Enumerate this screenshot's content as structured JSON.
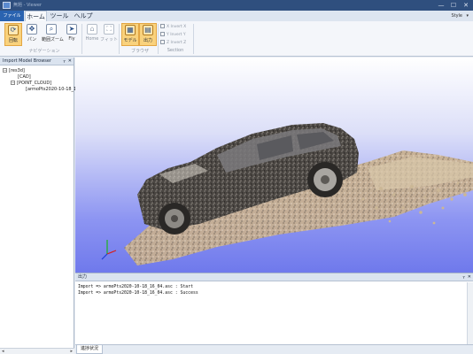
{
  "window": {
    "title": "無題 - Viewer",
    "min_glyph": "—",
    "max_glyph": "☐",
    "close_glyph": "✕"
  },
  "menu": {
    "file": "ファイル",
    "home": "ホーム",
    "tools": "ツール",
    "help": "ヘルプ",
    "style_label": "Style",
    "style_caret": "▾"
  },
  "ribbon": {
    "navigation": {
      "group_label": "ナビゲーション",
      "buttons": [
        {
          "label": "回転",
          "icon": "rotate-icon",
          "glyph": "⟳",
          "highlighted": true
        },
        {
          "label": "パン",
          "icon": "pan-icon",
          "glyph": "✥",
          "highlighted": false
        },
        {
          "label": "範囲ズーム",
          "icon": "zoom-box-icon",
          "glyph": "⌕",
          "highlighted": false
        },
        {
          "label": "Fly",
          "icon": "fly-icon",
          "glyph": "➤",
          "highlighted": false
        },
        {
          "label": "Home",
          "icon": "home-icon",
          "glyph": "⌂",
          "highlighted": false,
          "dim": true
        },
        {
          "label": "フィット",
          "icon": "fit-icon",
          "glyph": "⛶",
          "highlighted": false,
          "dim": true
        }
      ]
    },
    "browse": {
      "group_label": "ブラウザ",
      "buttons": [
        {
          "label": "モデル",
          "icon": "model-icon",
          "glyph": "▦",
          "highlighted": true
        },
        {
          "label": "出力",
          "icon": "output-icon",
          "glyph": "▤",
          "highlighted": true
        }
      ]
    },
    "section": {
      "group_label": "Section",
      "options": [
        {
          "axis": "X",
          "label": "Invert X"
        },
        {
          "axis": "Y",
          "label": "Invert Y"
        },
        {
          "axis": "Z",
          "label": "Invert Z"
        }
      ]
    }
  },
  "model_browser": {
    "title": "Import Model Browser",
    "pin_glyph": "ᚁ",
    "close_glyph": "✕",
    "tree": {
      "root": "[res3d]",
      "cad": "[CAD]",
      "point_cloud": "[POINT_CLOUD]",
      "item": "[armoPts2020-10-18_1"
    },
    "expand_glyph": "−",
    "scroll_left": "◂",
    "scroll_right": "▸"
  },
  "output_panel": {
    "title": "出力",
    "pin_glyph": "ᚁ",
    "close_glyph": "✕",
    "lines": [
      "Import => armoPts2020-10-18_16_04.asc : Start",
      "Import => armoPts2020-10-18_16_04.asc : Success"
    ]
  },
  "bottom_tabs": {
    "progress": "進捗状況"
  },
  "colors": {
    "titlebar": "#2f4f7e",
    "file_tab": "#2a63b0",
    "highlight": "#f9d27d",
    "viewport_top": "#ffffff",
    "viewport_bottom": "#6f79ec"
  }
}
